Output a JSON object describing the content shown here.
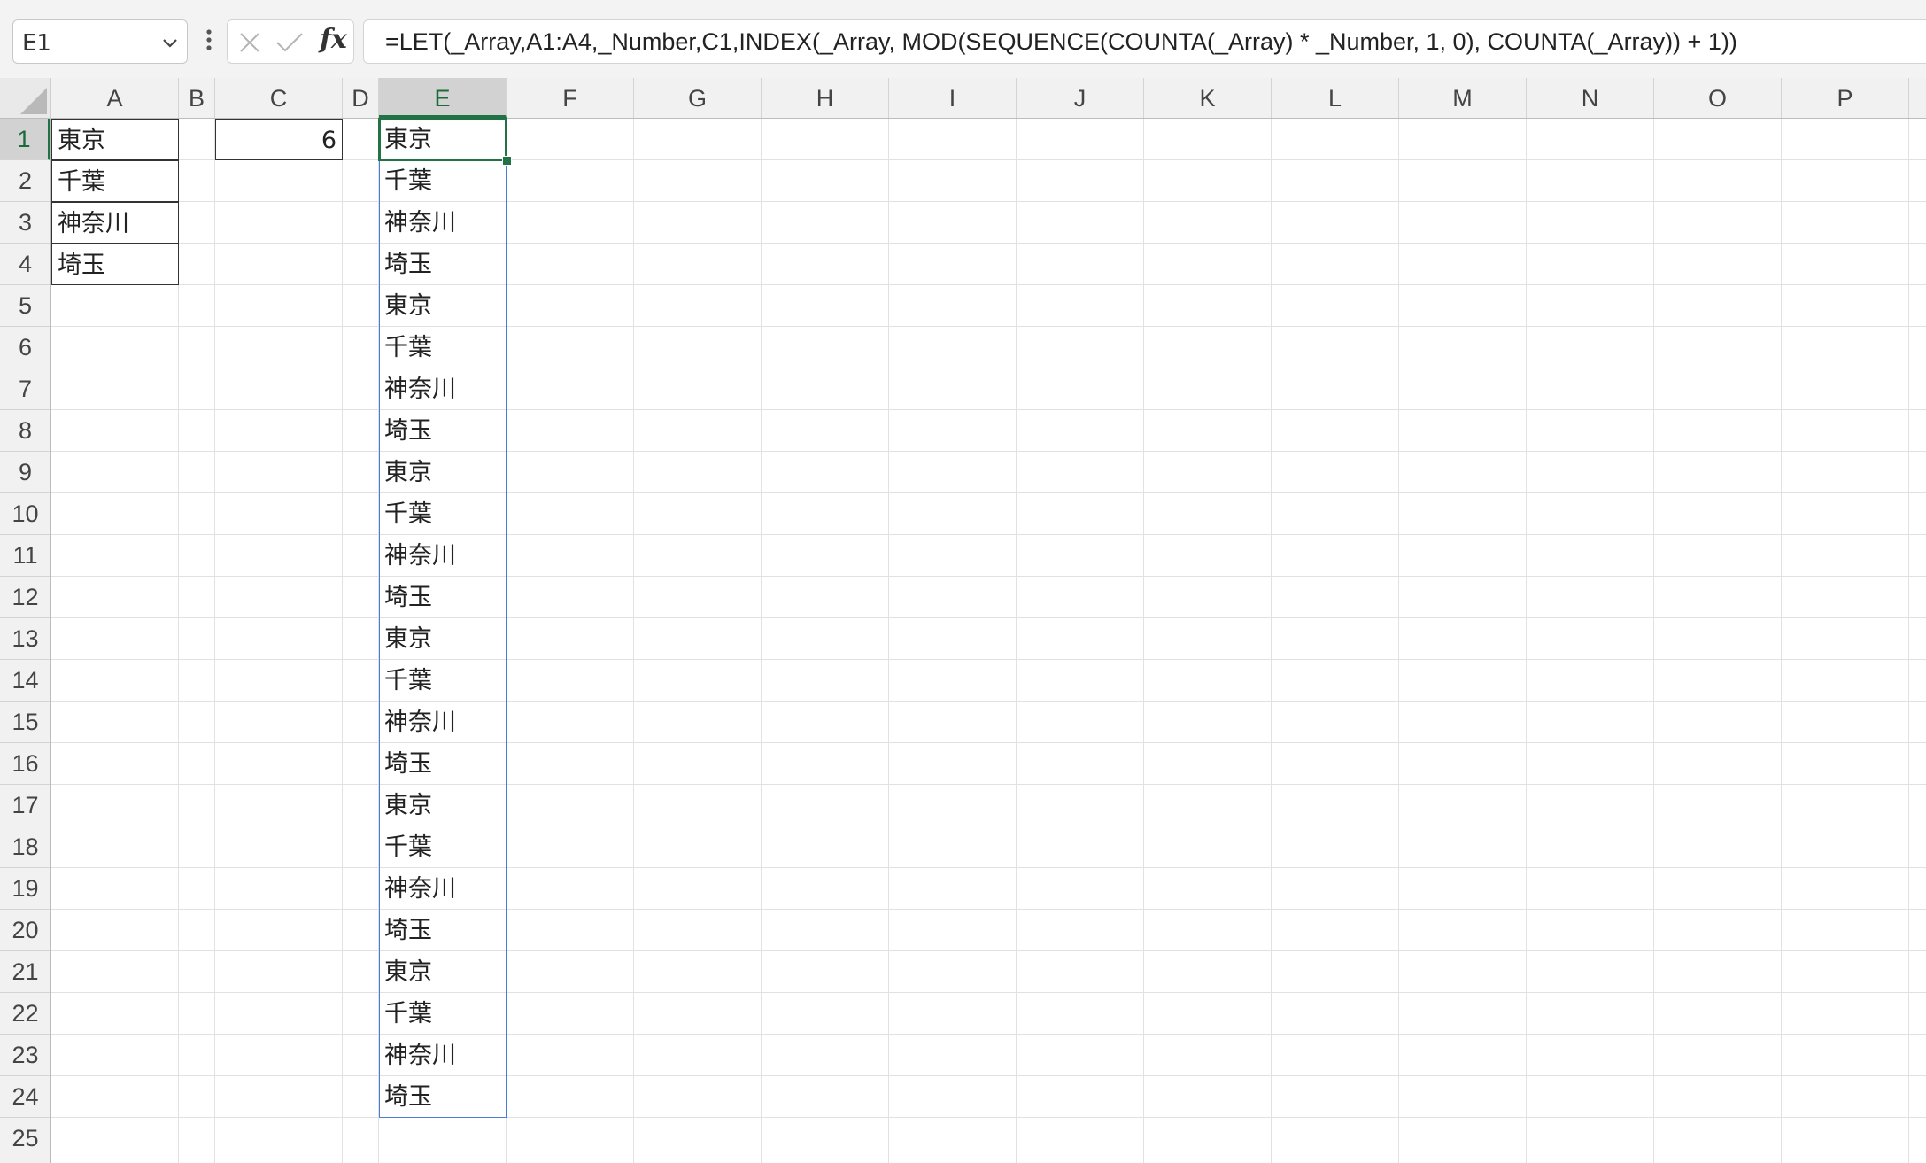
{
  "formula_bar": {
    "name_box": "E1",
    "formula": "=LET(_Array,A1:A4,_Number,C1,INDEX(_Array, MOD(SEQUENCE(COUNTA(_Array) * _Number, 1, 0), COUNTA(_Array)) + 1))"
  },
  "sheet": {
    "active_cell": "E1",
    "columns": [
      "A",
      "B",
      "C",
      "D",
      "E",
      "F",
      "G",
      "H",
      "I",
      "J",
      "K",
      "L",
      "M",
      "N",
      "O",
      "P"
    ],
    "rows": [
      "1",
      "2",
      "3",
      "4",
      "5",
      "6",
      "7",
      "8",
      "9",
      "10",
      "11",
      "12",
      "13",
      "14",
      "15",
      "16",
      "17",
      "18",
      "19",
      "20",
      "21",
      "22",
      "23",
      "24",
      "25"
    ],
    "column_a": [
      "東京",
      "千葉",
      "神奈川",
      "埼玉"
    ],
    "c1_value": "6",
    "column_e": [
      "東京",
      "千葉",
      "神奈川",
      "埼玉",
      "東京",
      "千葉",
      "神奈川",
      "埼玉",
      "東京",
      "千葉",
      "神奈川",
      "埼玉",
      "東京",
      "千葉",
      "神奈川",
      "埼玉",
      "東京",
      "千葉",
      "神奈川",
      "埼玉",
      "東京",
      "千葉",
      "神奈川",
      "埼玉"
    ]
  },
  "colors": {
    "accent": "#217346",
    "spill_border": "#4a7bd8",
    "gridline": "#e1e1e1"
  }
}
